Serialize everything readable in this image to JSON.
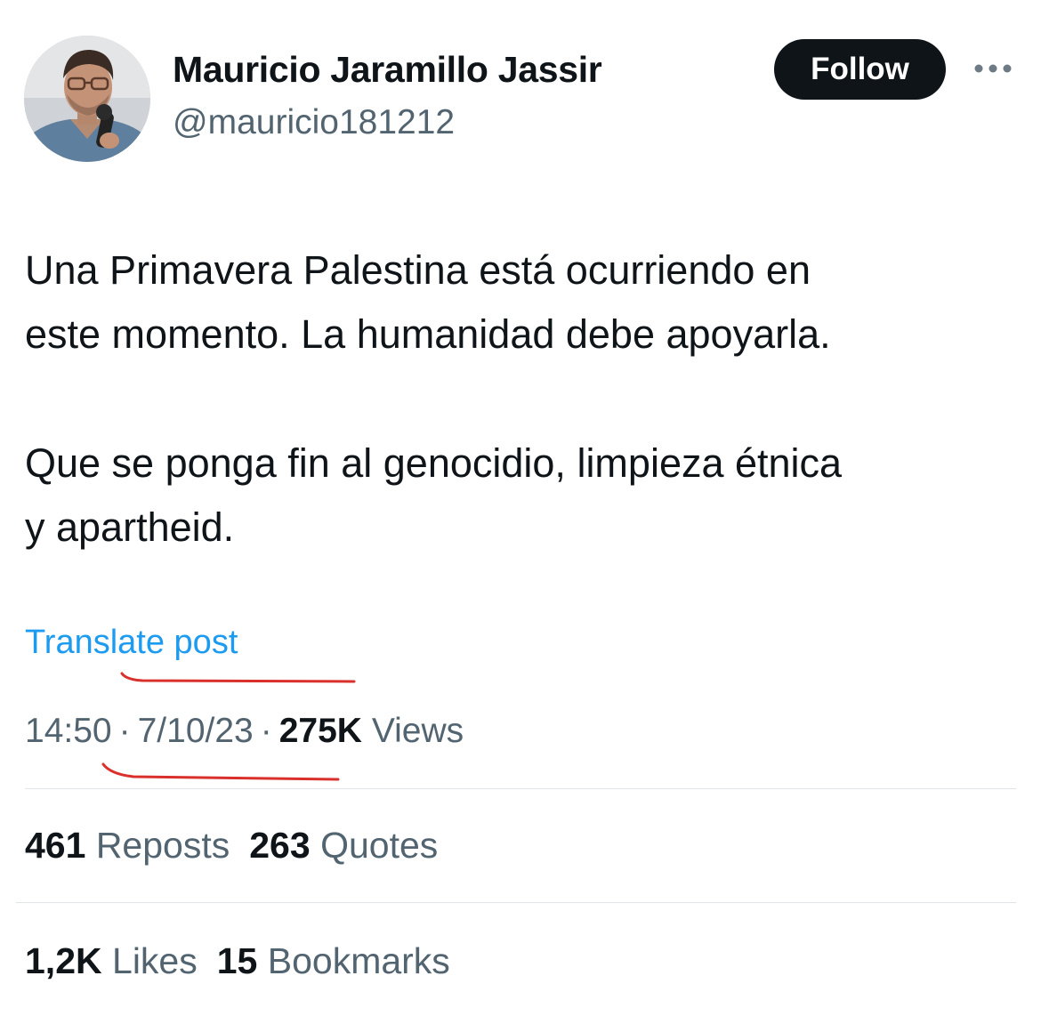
{
  "author": {
    "name": "Mauricio Jaramillo Jassir",
    "handle": "@mauricio181212"
  },
  "follow_label": "Follow",
  "more_icon": "more-horizontal-icon",
  "tweet": {
    "paragraphs": [
      "Una Primavera Palestina está ocurriendo en\neste momento. La humanidad debe apoyarla.",
      "Que se ponga fin al genocidio, limpieza étnica\ny apartheid."
    ]
  },
  "translate_label": "Translate post",
  "meta": {
    "time": "14:50",
    "separator": "·",
    "date": "7/10/23",
    "views_count": "275K",
    "views_label": "Views"
  },
  "stats": {
    "reposts_count": "461",
    "reposts_label": "Reposts",
    "quotes_count": "263",
    "quotes_label": "Quotes",
    "likes_count": "1,2K",
    "likes_label": "Likes",
    "bookmarks_count": "15",
    "bookmarks_label": "Bookmarks"
  },
  "colors": {
    "text": "#0f1419",
    "secondary": "#536471",
    "link": "#1d9bf0",
    "annotation": "#d9302c"
  }
}
